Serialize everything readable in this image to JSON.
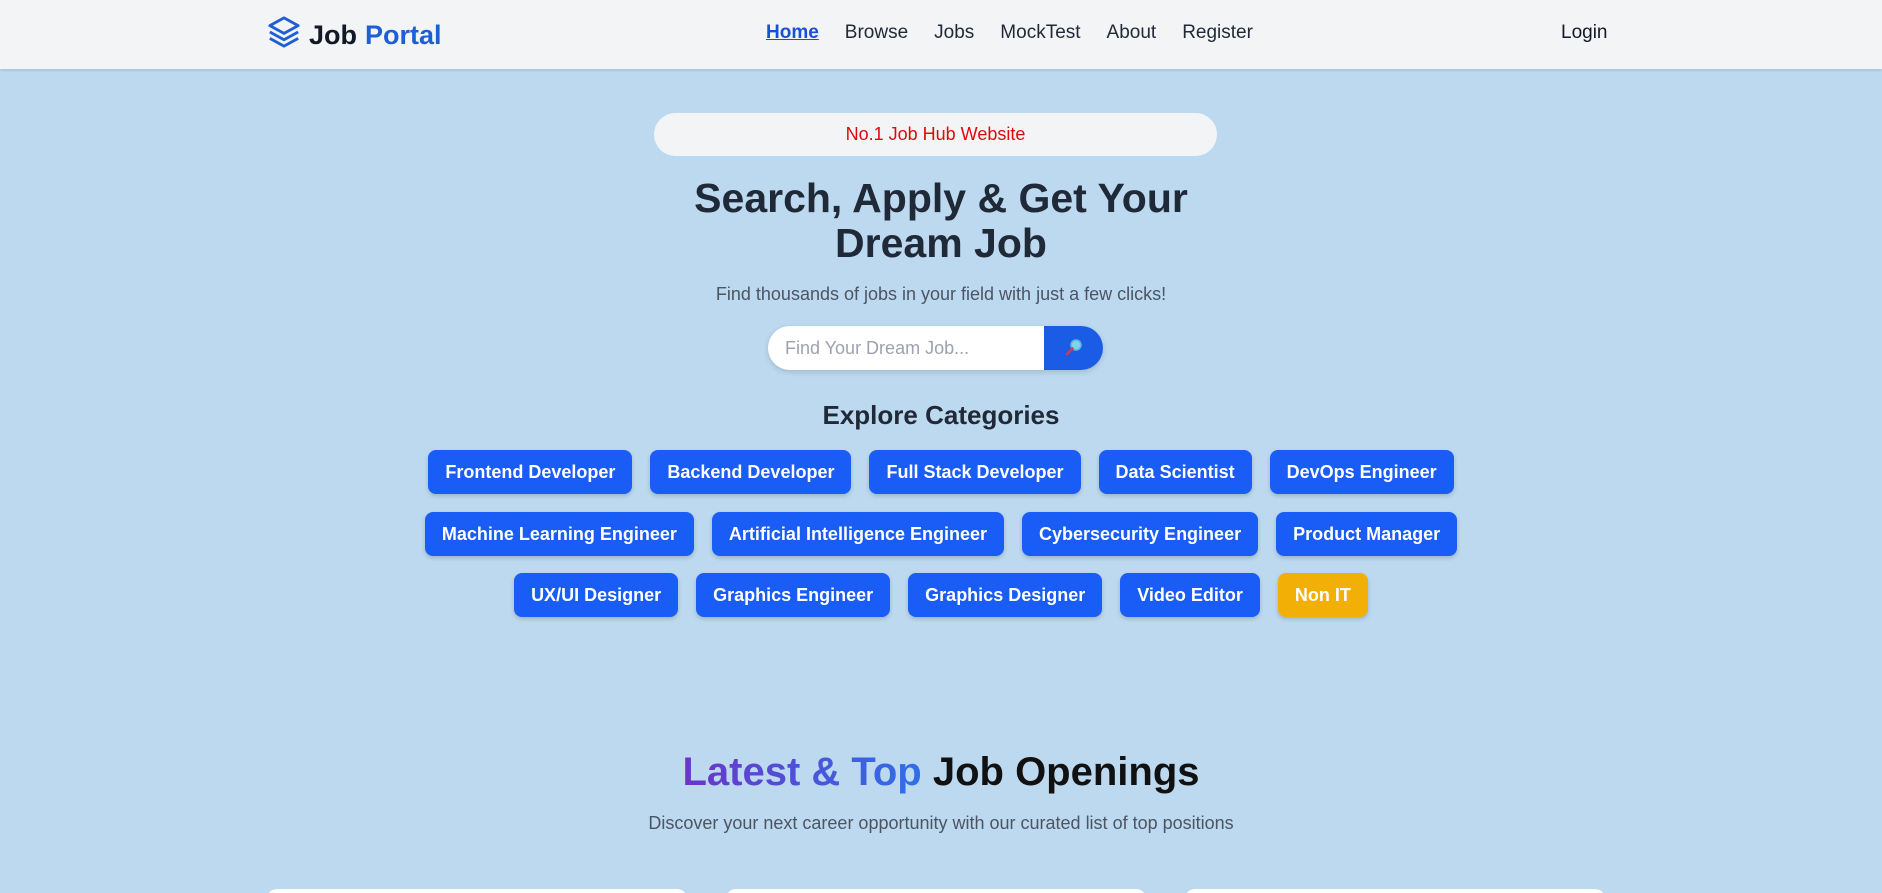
{
  "brand": {
    "first": "Job",
    "second": "Portal",
    "icon": "layers-icon"
  },
  "nav": {
    "items": [
      {
        "label": "Home",
        "active": true
      },
      {
        "label": "Browse",
        "active": false
      },
      {
        "label": "Jobs",
        "active": false
      },
      {
        "label": "MockTest",
        "active": false
      },
      {
        "label": "About",
        "active": false
      },
      {
        "label": "Register",
        "active": false
      }
    ],
    "login": "Login"
  },
  "hero": {
    "badge": "No.1 Job Hub Website",
    "title_line1": "Search, Apply & Get Your",
    "title_line2": "Dream Job",
    "subtitle": "Find thousands of jobs in your field with just a few clicks!",
    "search_placeholder": "Find Your Dream Job...",
    "search_icon": "magnifier-icon"
  },
  "categories": {
    "title": "Explore Categories",
    "rows": [
      [
        "Frontend Developer",
        "Backend Developer",
        "Full Stack Developer",
        "Data Scientist",
        "DevOps Engineer"
      ],
      [
        "Machine Learning Engineer",
        "Artificial Intelligence Engineer",
        "Cybersecurity Engineer",
        "Product Manager"
      ],
      [
        "UX/UI Designer",
        "Graphics Engineer",
        "Graphics Designer",
        "Video Editor",
        "Non IT"
      ]
    ],
    "highlighted": "Non IT"
  },
  "latest": {
    "title_grad": "Latest & Top",
    "title_rest": "Job Openings",
    "subtitle": "Discover your next career opportunity with our curated list of top positions"
  },
  "colors": {
    "background": "#bdd9ef",
    "primary": "#1a5cf6",
    "highlight": "#f2b006",
    "badge_text": "#dc0b0b"
  }
}
